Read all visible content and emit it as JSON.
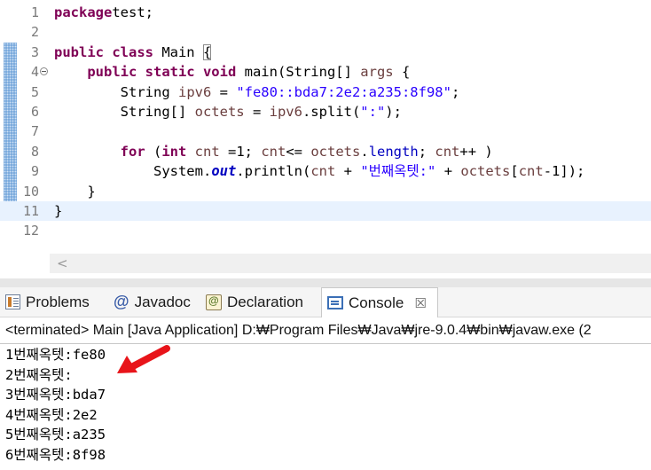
{
  "editor": {
    "lines": [
      {
        "num": "1",
        "parts": [
          [
            "kw",
            "package"
          ],
          [
            "",
            "test;"
          ]
        ]
      },
      {
        "num": "2",
        "parts": []
      },
      {
        "num": "3",
        "parts": [
          [
            "kw",
            "public class"
          ],
          [
            "",
            " Main "
          ],
          [
            "box",
            "{"
          ]
        ]
      },
      {
        "num": "4",
        "fold": true,
        "parts": [
          [
            "",
            "    "
          ],
          [
            "kw",
            "public static void"
          ],
          [
            "",
            " main(String[] "
          ],
          [
            "var",
            "args"
          ],
          [
            "",
            " {"
          ]
        ]
      },
      {
        "num": "5",
        "parts": [
          [
            "",
            "        String "
          ],
          [
            "var",
            "ipv6"
          ],
          [
            "",
            " = "
          ],
          [
            "str",
            "\"fe80::bda7:2e2:a235:8f98\""
          ],
          [
            "",
            ";"
          ]
        ]
      },
      {
        "num": "6",
        "parts": [
          [
            "",
            "        String[] "
          ],
          [
            "var",
            "octets"
          ],
          [
            "",
            " = "
          ],
          [
            "var",
            "ipv6"
          ],
          [
            "",
            ".split("
          ],
          [
            "str",
            "\":\""
          ],
          [
            "",
            ");"
          ]
        ]
      },
      {
        "num": "7",
        "parts": []
      },
      {
        "num": "8",
        "parts": [
          [
            "",
            "        "
          ],
          [
            "kw",
            "for"
          ],
          [
            "",
            " ("
          ],
          [
            "kw",
            "int"
          ],
          [
            "",
            " "
          ],
          [
            "var",
            "cnt"
          ],
          [
            "",
            " =1; "
          ],
          [
            "var",
            "cnt"
          ],
          [
            "",
            "<= "
          ],
          [
            "var",
            "octets"
          ],
          [
            "",
            "."
          ],
          [
            "fld2",
            "length"
          ],
          [
            "",
            "; "
          ],
          [
            "var",
            "cnt"
          ],
          [
            "",
            "++ )"
          ]
        ]
      },
      {
        "num": "9",
        "parts": [
          [
            "",
            "            System."
          ],
          [
            "fld",
            "out"
          ],
          [
            "",
            ".println("
          ],
          [
            "var",
            "cnt"
          ],
          [
            "",
            " + "
          ],
          [
            "str",
            "\"번째옥텟:\""
          ],
          [
            "",
            " + "
          ],
          [
            "var",
            "octets"
          ],
          [
            "",
            "["
          ],
          [
            "var",
            "cnt"
          ],
          [
            "",
            "-1]);"
          ]
        ]
      },
      {
        "num": "10",
        "parts": [
          [
            "",
            "    }"
          ]
        ]
      },
      {
        "num": "11",
        "current": true,
        "parts": [
          [
            "",
            "}"
          ]
        ]
      },
      {
        "num": "12",
        "parts": []
      }
    ],
    "scroll_left_glyph": "<"
  },
  "tabs": {
    "problems": "Problems",
    "javadoc_icon": "@",
    "javadoc": "Javadoc",
    "declaration": "Declaration",
    "console": "Console",
    "close_glyph": "☒"
  },
  "console": {
    "header": "<terminated> Main [Java Application] D:₩Program Files₩Java₩jre-9.0.4₩bin₩javaw.exe (2",
    "output": [
      "1번째옥텟:fe80",
      "2번째옥텟:",
      "3번째옥텟:bda7",
      "4번째옥텟:2e2",
      "5번째옥텟:a235",
      "6번째옥텟:8f98"
    ]
  },
  "icons": {
    "problems": "problems-icon",
    "javadoc": "at-icon",
    "declaration": "declaration-icon",
    "console": "console-icon",
    "close": "close-icon",
    "fold": "fold-collapse-icon",
    "arrow": "red-arrow-annotation"
  },
  "colors": {
    "keyword": "#7f0055",
    "string": "#2a00ff",
    "variable": "#6a3e3e",
    "field": "#0000c0",
    "change_bar": "#6aa0d8",
    "current_line": "#e8f2fe",
    "arrow": "#e8141a"
  }
}
